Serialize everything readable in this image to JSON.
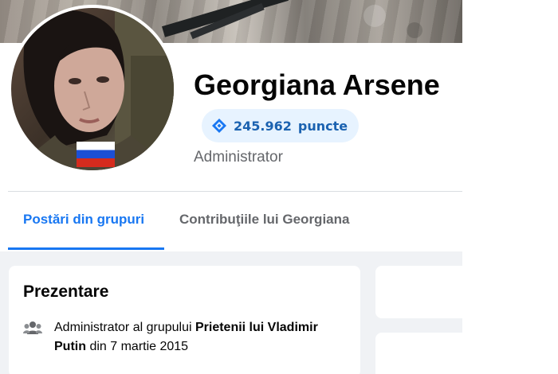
{
  "profile": {
    "name": "Georgiana Arsene",
    "points_value": "245.962",
    "points_unit": "puncte",
    "role": "Administrator"
  },
  "tabs": [
    {
      "label": "Postări din grupuri",
      "active": true
    },
    {
      "label": "Contribuţiile lui Georgiana",
      "active": false
    }
  ],
  "intro": {
    "title": "Prezentare",
    "text_prefix": "Administrator al grupului ",
    "group_name": "Prietenii lui Vladimir Putin",
    "text_suffix": " din 7 martie 2015"
  },
  "icons": {
    "points": "diamond-badge-icon",
    "members": "group-members-icon",
    "flag": "russian-flag"
  },
  "colors": {
    "accent": "#1877f2",
    "points_bg": "#e7f3ff",
    "points_text": "#1b62b0",
    "muted": "#65676b"
  }
}
